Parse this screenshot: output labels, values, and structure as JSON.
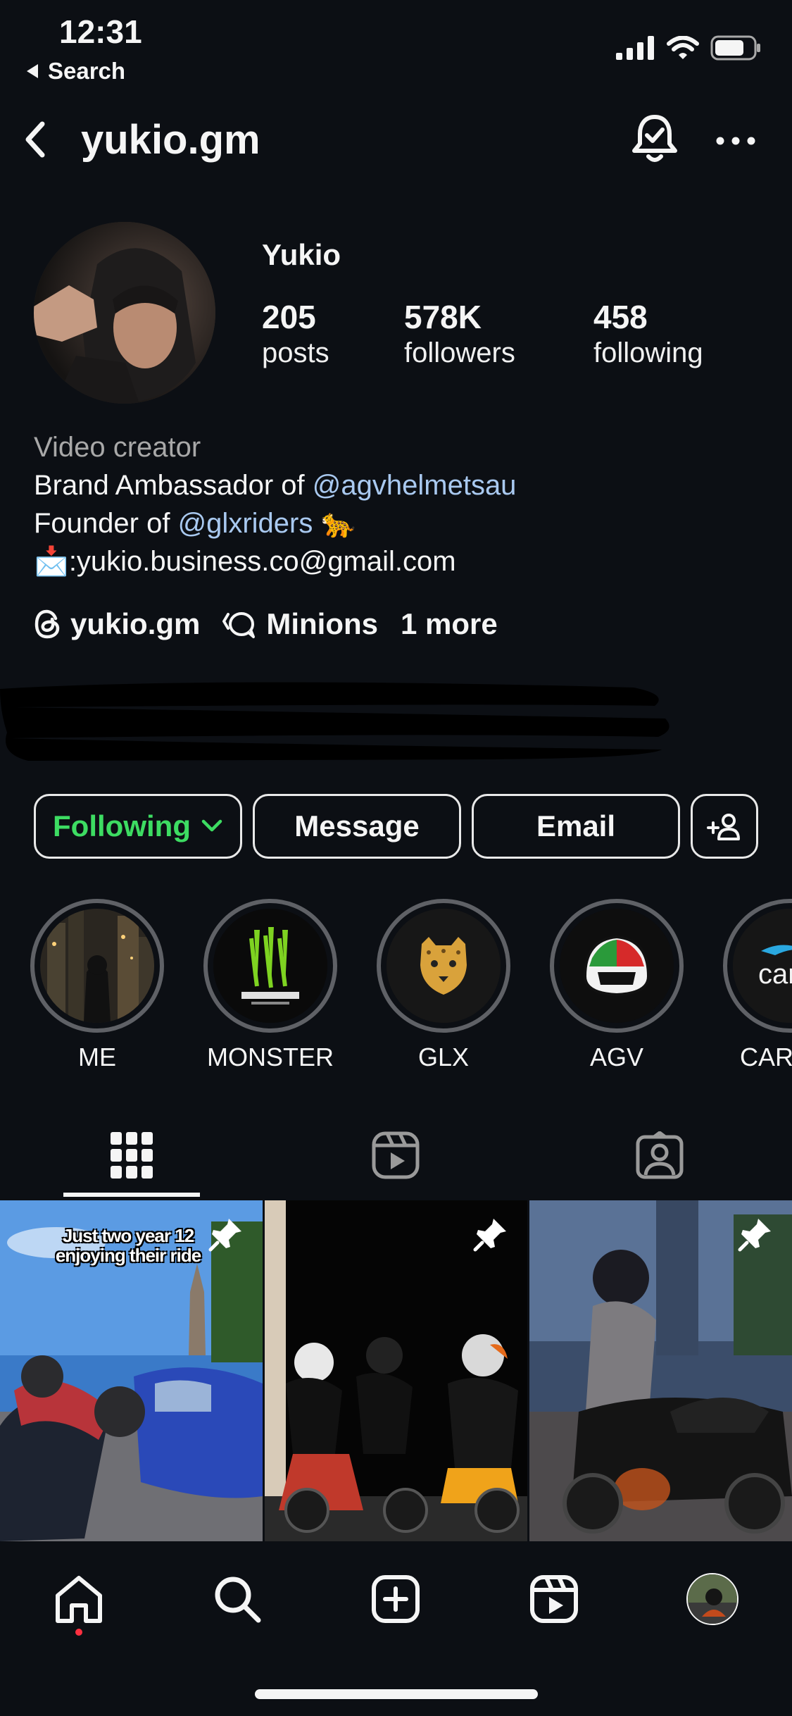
{
  "status_bar": {
    "time": "12:31",
    "back_app": "Search"
  },
  "header": {
    "username": "yukio.gm"
  },
  "profile": {
    "display_name": "Yukio",
    "stats": [
      {
        "value": "205",
        "label": "posts"
      },
      {
        "value": "578K",
        "label": "followers"
      },
      {
        "value": "458",
        "label": "following"
      }
    ],
    "bio": {
      "category": "Video creator",
      "line1_prefix": "Brand Ambassador of ",
      "line1_mention": "@agvhelmetsau",
      "line2_prefix": "Founder of ",
      "line2_mention": "@glxriders",
      "line2_emoji": "🐆",
      "line3_emoji": "📩",
      "line3_text": ":yukio.business.co@gmail.com"
    },
    "links": {
      "threads": "yukio.gm",
      "channel": "Minions",
      "more": "1 more"
    }
  },
  "actions": {
    "following": "Following",
    "message": "Message",
    "email": "Email"
  },
  "highlights": [
    {
      "label": "ME"
    },
    {
      "label": "MONSTER"
    },
    {
      "label": "GLX"
    },
    {
      "label": "AGV"
    },
    {
      "label": "CAR"
    }
  ],
  "posts": [
    {
      "caption": "Just two year 12 enjoying their ride",
      "pinned": true
    },
    {
      "caption": "",
      "pinned": true
    },
    {
      "caption": "",
      "pinned": true
    }
  ],
  "colors": {
    "background": "#0c0f14",
    "following_green": "#3ddc62",
    "mention_blue": "#a9c9f0",
    "notification_dot": "#ff3040"
  },
  "icons": {
    "header": [
      "back-chevron-icon",
      "notification-bell-check-icon",
      "more-icon"
    ],
    "tabs": [
      "grid-icon",
      "reels-icon",
      "tagged-icon"
    ],
    "nav": [
      "home-icon",
      "search-icon",
      "create-icon",
      "reels-icon",
      "profile-avatar"
    ]
  }
}
